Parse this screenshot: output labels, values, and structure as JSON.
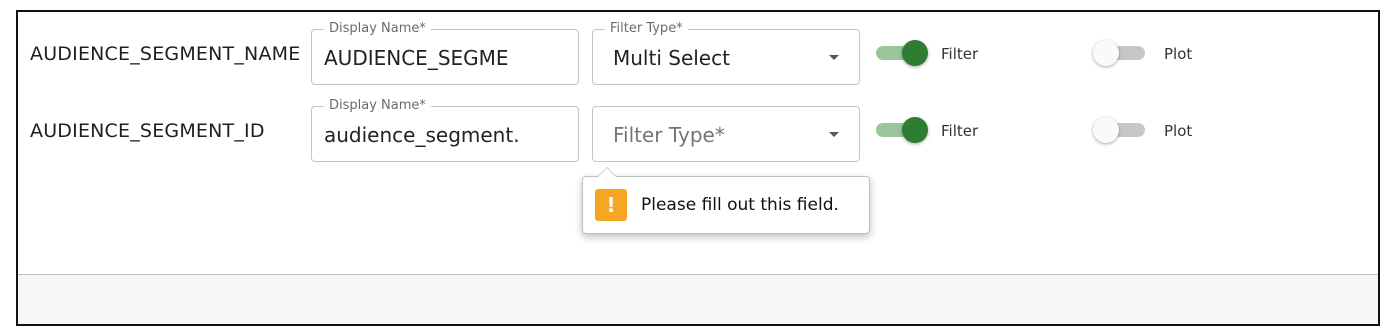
{
  "rows": [
    {
      "field_name": "AUDIENCE_SEGMENT_NAME",
      "display_name_label": "Display Name*",
      "display_name_value": "AUDIENCE_SEGME",
      "filter_type_label": "Filter Type*",
      "filter_type_value": "Multi Select",
      "filter_toggle": {
        "label": "Filter",
        "on": true
      },
      "plot_toggle": {
        "label": "Plot",
        "on": false
      }
    },
    {
      "field_name": "AUDIENCE_SEGMENT_ID",
      "display_name_label": "Display Name*",
      "display_name_value": "audience_segment.",
      "filter_type_placeholder": "Filter Type*",
      "filter_toggle": {
        "label": "Filter",
        "on": true
      },
      "plot_toggle": {
        "label": "Plot",
        "on": false
      }
    }
  ],
  "validation_tooltip": {
    "icon": "warning-icon",
    "message": "Please fill out this field."
  },
  "colors": {
    "toggle_on_thumb": "#2e7d32",
    "toggle_on_track": "#9ac59b",
    "toggle_off_track": "#c7c7c7",
    "warning": "#f5a623"
  }
}
